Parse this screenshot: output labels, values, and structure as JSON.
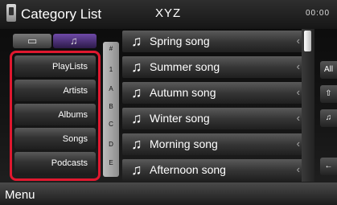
{
  "header": {
    "title": "Category List",
    "center_title": "XYZ",
    "time": "00:00"
  },
  "tabs": [
    {
      "icon": "card-icon",
      "glyph": "▭"
    },
    {
      "icon": "music-note-icon",
      "glyph": "♫"
    }
  ],
  "categories": [
    "PlayLists",
    "Artists",
    "Albums",
    "Songs",
    "Podcasts"
  ],
  "alpha_index": [
    "#",
    "1",
    "A",
    "B",
    "C",
    "D",
    "E"
  ],
  "songs": [
    "Spring song",
    "Summer song",
    "Autumn song",
    "Winter song",
    "Morning song",
    "Afternoon song"
  ],
  "song_icon": "♫",
  "chevron": "‹",
  "right_controls": [
    "All",
    "⇧",
    "♫",
    "←"
  ],
  "footer": {
    "menu_label": "Menu"
  },
  "colors": {
    "highlight_border": "#e0182f",
    "tab_active": "#6f4aa8"
  }
}
